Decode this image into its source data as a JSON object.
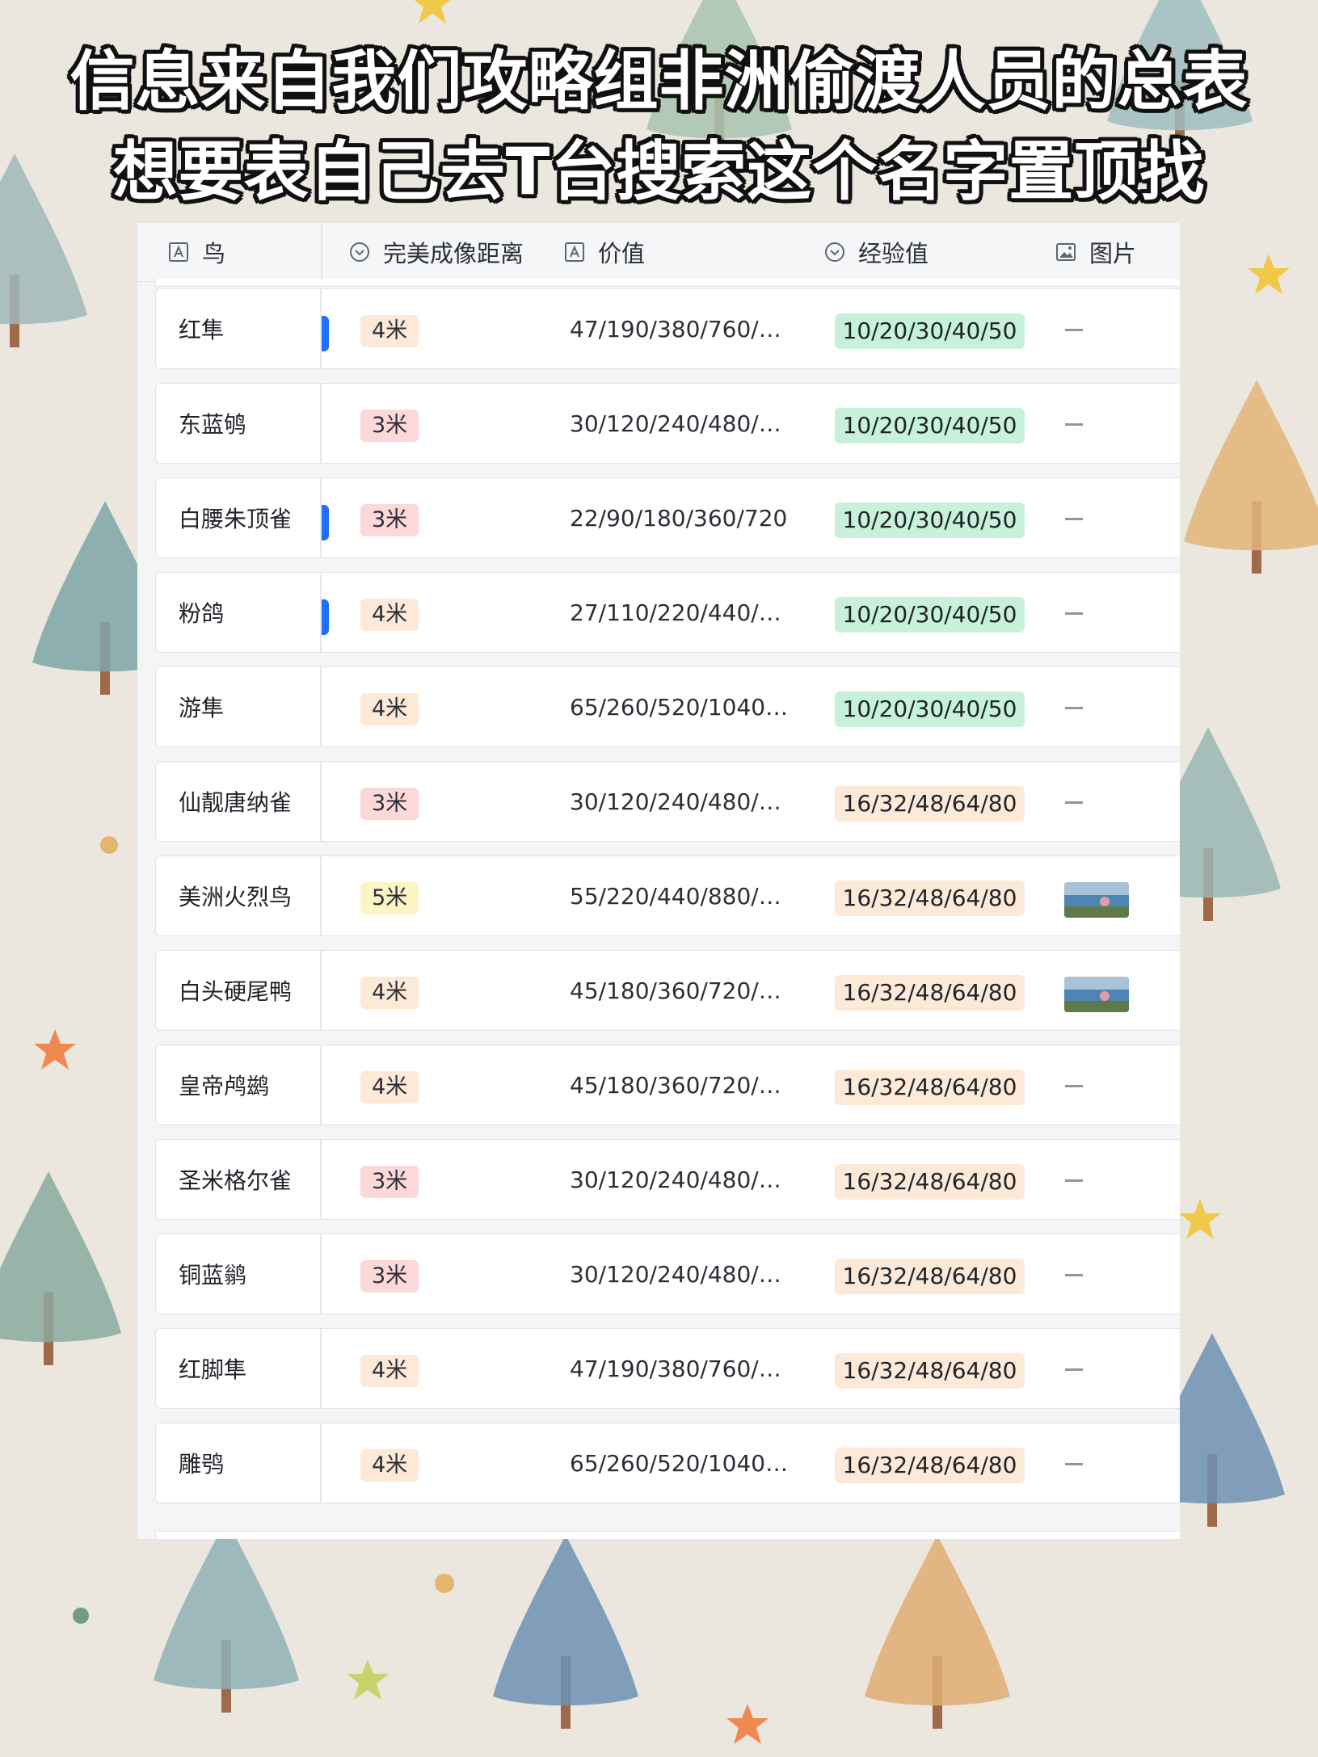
{
  "headline": {
    "line1": "信息来自我们攻略组非洲偷渡人员的总表",
    "line2": "想要表自己去T台搜索这个名字置顶找"
  },
  "table": {
    "columns": [
      {
        "label": "鸟",
        "icon": "text-field-icon"
      },
      {
        "label": "完美成像距离",
        "icon": "single-select-icon"
      },
      {
        "label": "价值",
        "icon": "text-field-icon"
      },
      {
        "label": "经验值",
        "icon": "single-select-icon"
      },
      {
        "label": "图片",
        "icon": "image-icon"
      }
    ],
    "colors": {
      "dist_4": "#fde9d8",
      "dist_3": "#fdd8d8",
      "dist_5": "#fcf4c4",
      "exp_green": "#c8f1dc",
      "exp_orange": "#fde9d8",
      "marker": "#1f6fff"
    },
    "rows": [
      {
        "name": "红隼",
        "dist": "4米",
        "value": "47/190/380/760/…",
        "exp": "10/20/30/40/50",
        "picture": "—"
      },
      {
        "name": "东蓝鸲",
        "dist": "3米",
        "value": "30/120/240/480/…",
        "exp": "10/20/30/40/50",
        "picture": "—"
      },
      {
        "name": "白腰朱顶雀",
        "dist": "3米",
        "value": "22/90/180/360/720",
        "exp": "10/20/30/40/50",
        "picture": "—"
      },
      {
        "name": "粉鸽",
        "dist": "4米",
        "value": "27/110/220/440/…",
        "exp": "10/20/30/40/50",
        "picture": "—"
      },
      {
        "name": "游隼",
        "dist": "4米",
        "value": "65/260/520/1040…",
        "exp": "10/20/30/40/50",
        "picture": "—"
      },
      {
        "name": "仙靓唐纳雀",
        "dist": "3米",
        "value": "30/120/240/480/…",
        "exp": "16/32/48/64/80",
        "picture": "—"
      },
      {
        "name": "美洲火烈鸟",
        "dist": "5米",
        "value": "55/220/440/880/…",
        "exp": "16/32/48/64/80",
        "picture": "thumbnail"
      },
      {
        "name": "白头硬尾鸭",
        "dist": "4米",
        "value": "45/180/360/720/…",
        "exp": "16/32/48/64/80",
        "picture": "thumbnail"
      },
      {
        "name": "皇帝鸬鹚",
        "dist": "4米",
        "value": "45/180/360/720/…",
        "exp": "16/32/48/64/80",
        "picture": "—"
      },
      {
        "name": "圣米格尔雀",
        "dist": "3米",
        "value": "30/120/240/480/…",
        "exp": "16/32/48/64/80",
        "picture": "—"
      },
      {
        "name": "铜蓝鹟",
        "dist": "3米",
        "value": "30/120/240/480/…",
        "exp": "16/32/48/64/80",
        "picture": "—"
      },
      {
        "name": "红脚隼",
        "dist": "4米",
        "value": "47/190/380/760/…",
        "exp": "16/32/48/64/80",
        "picture": "—"
      },
      {
        "name": "雕鸮",
        "dist": "4米",
        "value": "65/260/520/1040…",
        "exp": "16/32/48/64/80",
        "picture": "—"
      }
    ]
  }
}
